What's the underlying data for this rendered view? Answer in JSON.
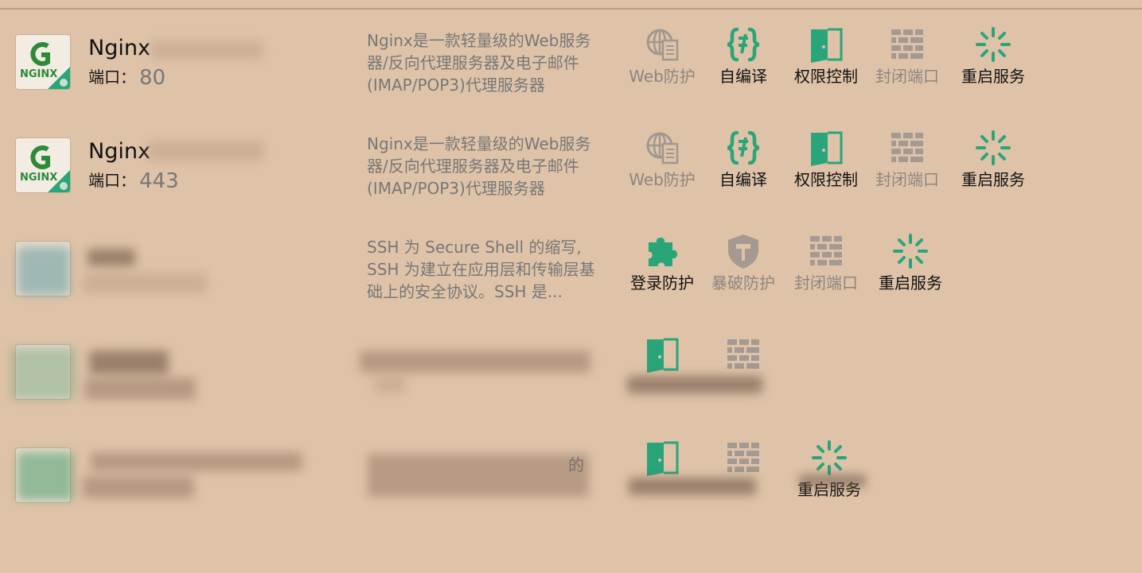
{
  "colors": {
    "background": "#dfc3a8",
    "accent_green": "#2aa57a",
    "disabled_gray": "#8d8580"
  },
  "rows": [
    {
      "name": "Nginx",
      "port_label": "端口：",
      "port_value": "80",
      "description": "Nginx是一款轻量级的Web服务器/反向代理服务器及电子邮件(IMAP/POP3)代理服务器",
      "actions": [
        {
          "label": "Web防护",
          "icon": "web-protection-icon",
          "enabled": false
        },
        {
          "label": "自编译",
          "icon": "code-brackets-icon",
          "enabled": true
        },
        {
          "label": "权限控制",
          "icon": "door-icon",
          "enabled": true
        },
        {
          "label": "封闭端口",
          "icon": "brick-wall-icon",
          "enabled": false
        },
        {
          "label": "重启服务",
          "icon": "spinner-icon",
          "enabled": true
        }
      ]
    },
    {
      "name": "Nginx",
      "port_label": "端口：",
      "port_value": "443",
      "description": "Nginx是一款轻量级的Web服务器/反向代理服务器及电子邮件(IMAP/POP3)代理服务器",
      "actions": [
        {
          "label": "Web防护",
          "icon": "web-protection-icon",
          "enabled": false
        },
        {
          "label": "自编译",
          "icon": "code-brackets-icon",
          "enabled": true
        },
        {
          "label": "权限控制",
          "icon": "door-icon",
          "enabled": true
        },
        {
          "label": "封闭端口",
          "icon": "brick-wall-icon",
          "enabled": false
        },
        {
          "label": "重启服务",
          "icon": "spinner-icon",
          "enabled": true
        }
      ]
    },
    {
      "description": "SSH 为 Secure Shell 的缩写, SSH 为建立在应用层和传输层基础上的安全协议。SSH 是...",
      "actions": [
        {
          "label": "登录防护",
          "icon": "puzzle-icon",
          "enabled": true
        },
        {
          "label": "暴破防护",
          "icon": "shield-hammer-icon",
          "enabled": false
        },
        {
          "label": "封闭端口",
          "icon": "brick-wall-icon",
          "enabled": false
        },
        {
          "label": "重启服务",
          "icon": "spinner-icon",
          "enabled": true
        }
      ]
    },
    {
      "actions": [
        {
          "label": "",
          "icon": "door-icon",
          "enabled": true
        },
        {
          "label": "",
          "icon": "brick-wall-icon",
          "enabled": false
        }
      ]
    },
    {
      "desc_fragment": "的",
      "actions": [
        {
          "label": "",
          "icon": "door-icon",
          "enabled": true
        },
        {
          "label": "",
          "icon": "brick-wall-icon",
          "enabled": false
        },
        {
          "label": "重启服务",
          "icon": "spinner-icon",
          "enabled": true
        }
      ]
    }
  ]
}
